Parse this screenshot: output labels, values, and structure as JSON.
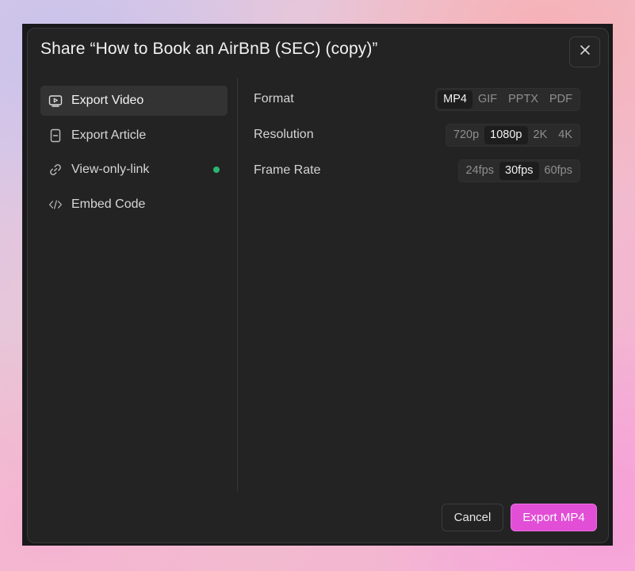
{
  "dialog": {
    "title": "Share “How to Book an AirBnB (SEC) (copy)”",
    "close_icon": "close-icon"
  },
  "sidebar": {
    "items": [
      {
        "label": "Export Video",
        "icon": "video-icon",
        "active": true
      },
      {
        "label": "Export Article",
        "icon": "document-icon",
        "active": false
      },
      {
        "label": "View-only-link",
        "icon": "link-icon",
        "active": false,
        "status": "#2bb673"
      },
      {
        "label": "Embed Code",
        "icon": "code-icon",
        "active": false
      }
    ]
  },
  "settings": {
    "format": {
      "label": "Format",
      "options": [
        "MP4",
        "GIF",
        "PPTX",
        "PDF"
      ],
      "selected": "MP4"
    },
    "resolution": {
      "label": "Resolution",
      "options": [
        "720p",
        "1080p",
        "2K",
        "4K"
      ],
      "selected": "1080p"
    },
    "frame_rate": {
      "label": "Frame Rate",
      "options": [
        "24fps",
        "30fps",
        "60fps"
      ],
      "selected": "30fps"
    }
  },
  "footer": {
    "cancel_label": "Cancel",
    "export_label": "Export MP4"
  },
  "colors": {
    "accent": "#e24ed6",
    "panel": "#232323",
    "status_active": "#2bb673"
  }
}
